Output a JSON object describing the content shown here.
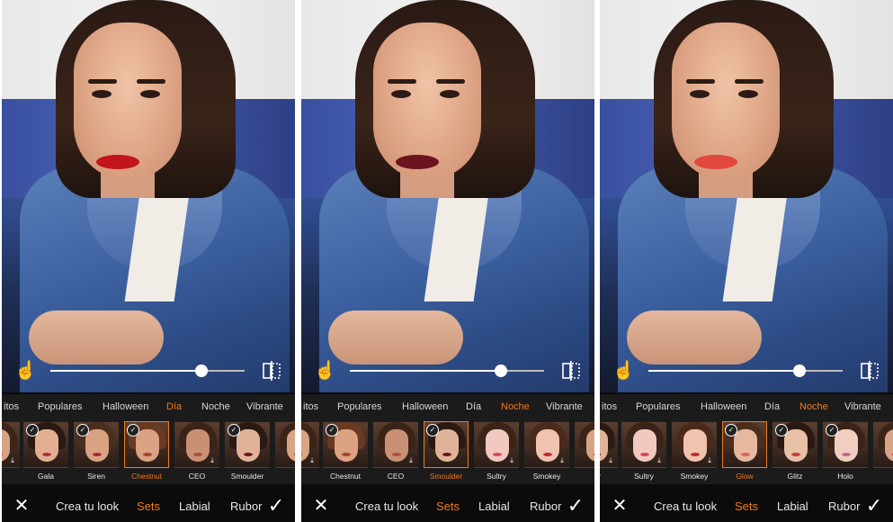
{
  "accent": "#f07a1c",
  "panels": [
    {
      "slider_value": 0.78,
      "lip_color": "#c2141c",
      "categories": [
        {
          "label": "itos",
          "active": false
        },
        {
          "label": "Populares",
          "active": false
        },
        {
          "label": "Halloween",
          "active": false
        },
        {
          "label": "Día",
          "active": true
        },
        {
          "label": "Noche",
          "active": false
        },
        {
          "label": "Vibrante",
          "active": false
        }
      ],
      "thumbs": [
        {
          "label": "u",
          "checked": false,
          "selected": false,
          "lip": "#c33b3b",
          "hair": "#3b2418",
          "skin": "#d8a486"
        },
        {
          "label": "Gala",
          "checked": true,
          "selected": false,
          "lip": "#b42d45",
          "hair": "#2a1812",
          "skin": "#e2b090"
        },
        {
          "label": "Siren",
          "checked": true,
          "selected": false,
          "lip": "#9e2b3a",
          "hair": "#4a2e1e",
          "skin": "#d9a283"
        },
        {
          "label": "Chestnut",
          "checked": true,
          "selected": true,
          "lip": "#a8432c",
          "hair": "#6a3a22",
          "skin": "#dba283"
        },
        {
          "label": "CEO",
          "checked": false,
          "selected": false,
          "lip": "#a85045",
          "hair": "#3a2418",
          "skin": "#c99074"
        },
        {
          "label": "Smoulder",
          "checked": true,
          "selected": false,
          "lip": "#6b1622",
          "hair": "#2b1a14",
          "skin": "#e0b399"
        },
        {
          "label": "",
          "checked": false,
          "selected": false,
          "lip": "#b02a30",
          "hair": "#3a2418",
          "skin": "#d8a486"
        }
      ],
      "tools": [
        {
          "label": "Crea tu look",
          "active": false
        },
        {
          "label": "Sets",
          "active": true
        },
        {
          "label": "Labial",
          "active": false
        },
        {
          "label": "Rubor",
          "active": false
        }
      ]
    },
    {
      "slider_value": 0.78,
      "lip_color": "#6b1420",
      "categories": [
        {
          "label": "itos",
          "active": false
        },
        {
          "label": "Populares",
          "active": false
        },
        {
          "label": "Halloween",
          "active": false
        },
        {
          "label": "Día",
          "active": false
        },
        {
          "label": "Noche",
          "active": true
        },
        {
          "label": "Vibrante",
          "active": false
        }
      ],
      "thumbs": [
        {
          "label": "",
          "checked": false,
          "selected": false,
          "lip": "#a85045",
          "hair": "#3b2418",
          "skin": "#d8a486"
        },
        {
          "label": "Chestnut",
          "checked": true,
          "selected": false,
          "lip": "#a8432c",
          "hair": "#6a3a22",
          "skin": "#dba283"
        },
        {
          "label": "CEO",
          "checked": false,
          "selected": false,
          "lip": "#a85045",
          "hair": "#3a2418",
          "skin": "#c99074"
        },
        {
          "label": "Smoulder",
          "checked": true,
          "selected": true,
          "lip": "#6b1622",
          "hair": "#2b1a14",
          "skin": "#e0b399"
        },
        {
          "label": "Sultry",
          "checked": false,
          "selected": false,
          "lip": "#d8455a",
          "hair": "#3a2418",
          "skin": "#f1c9c0"
        },
        {
          "label": "Smokey",
          "checked": false,
          "selected": false,
          "lip": "#c22a2a",
          "hair": "#4a2a1a",
          "skin": "#f0c2b0"
        },
        {
          "label": "",
          "checked": false,
          "selected": false,
          "lip": "#b02a30",
          "hair": "#3a2418",
          "skin": "#d8a486"
        }
      ],
      "tools": [
        {
          "label": "Crea tu look",
          "active": false
        },
        {
          "label": "Sets",
          "active": true
        },
        {
          "label": "Labial",
          "active": false
        },
        {
          "label": "Rubor",
          "active": false
        }
      ]
    },
    {
      "slider_value": 0.78,
      "lip_color": "#e2483f",
      "categories": [
        {
          "label": "itos",
          "active": false
        },
        {
          "label": "Populares",
          "active": false
        },
        {
          "label": "Halloween",
          "active": false
        },
        {
          "label": "Día",
          "active": false
        },
        {
          "label": "Noche",
          "active": true
        },
        {
          "label": "Vibrante",
          "active": false
        }
      ],
      "thumbs": [
        {
          "label": "der",
          "checked": false,
          "selected": false,
          "lip": "#6b1622",
          "hair": "#2b1a14",
          "skin": "#e0b399"
        },
        {
          "label": "Sultry",
          "checked": false,
          "selected": false,
          "lip": "#d8455a",
          "hair": "#3a2418",
          "skin": "#f1c9c0"
        },
        {
          "label": "Smokey",
          "checked": false,
          "selected": false,
          "lip": "#c22a2a",
          "hair": "#4a2a1a",
          "skin": "#f0c2b0"
        },
        {
          "label": "Glow",
          "checked": true,
          "selected": true,
          "lip": "#d9685a",
          "hair": "#4a2e1e",
          "skin": "#e6b8a0"
        },
        {
          "label": "Glitz",
          "checked": true,
          "selected": false,
          "lip": "#c83a4a",
          "hair": "#2a1812",
          "skin": "#e8c0a6"
        },
        {
          "label": "Holo",
          "checked": true,
          "selected": false,
          "lip": "#c46a8a",
          "hair": "#3a2418",
          "skin": "#f0cfc0"
        },
        {
          "label": "",
          "checked": false,
          "selected": false,
          "lip": "#b02a30",
          "hair": "#3a2418",
          "skin": "#d8a486"
        }
      ],
      "tools": [
        {
          "label": "Crea tu look",
          "active": false
        },
        {
          "label": "Sets",
          "active": true
        },
        {
          "label": "Labial",
          "active": false
        },
        {
          "label": "Rubor",
          "active": false
        }
      ]
    }
  ]
}
